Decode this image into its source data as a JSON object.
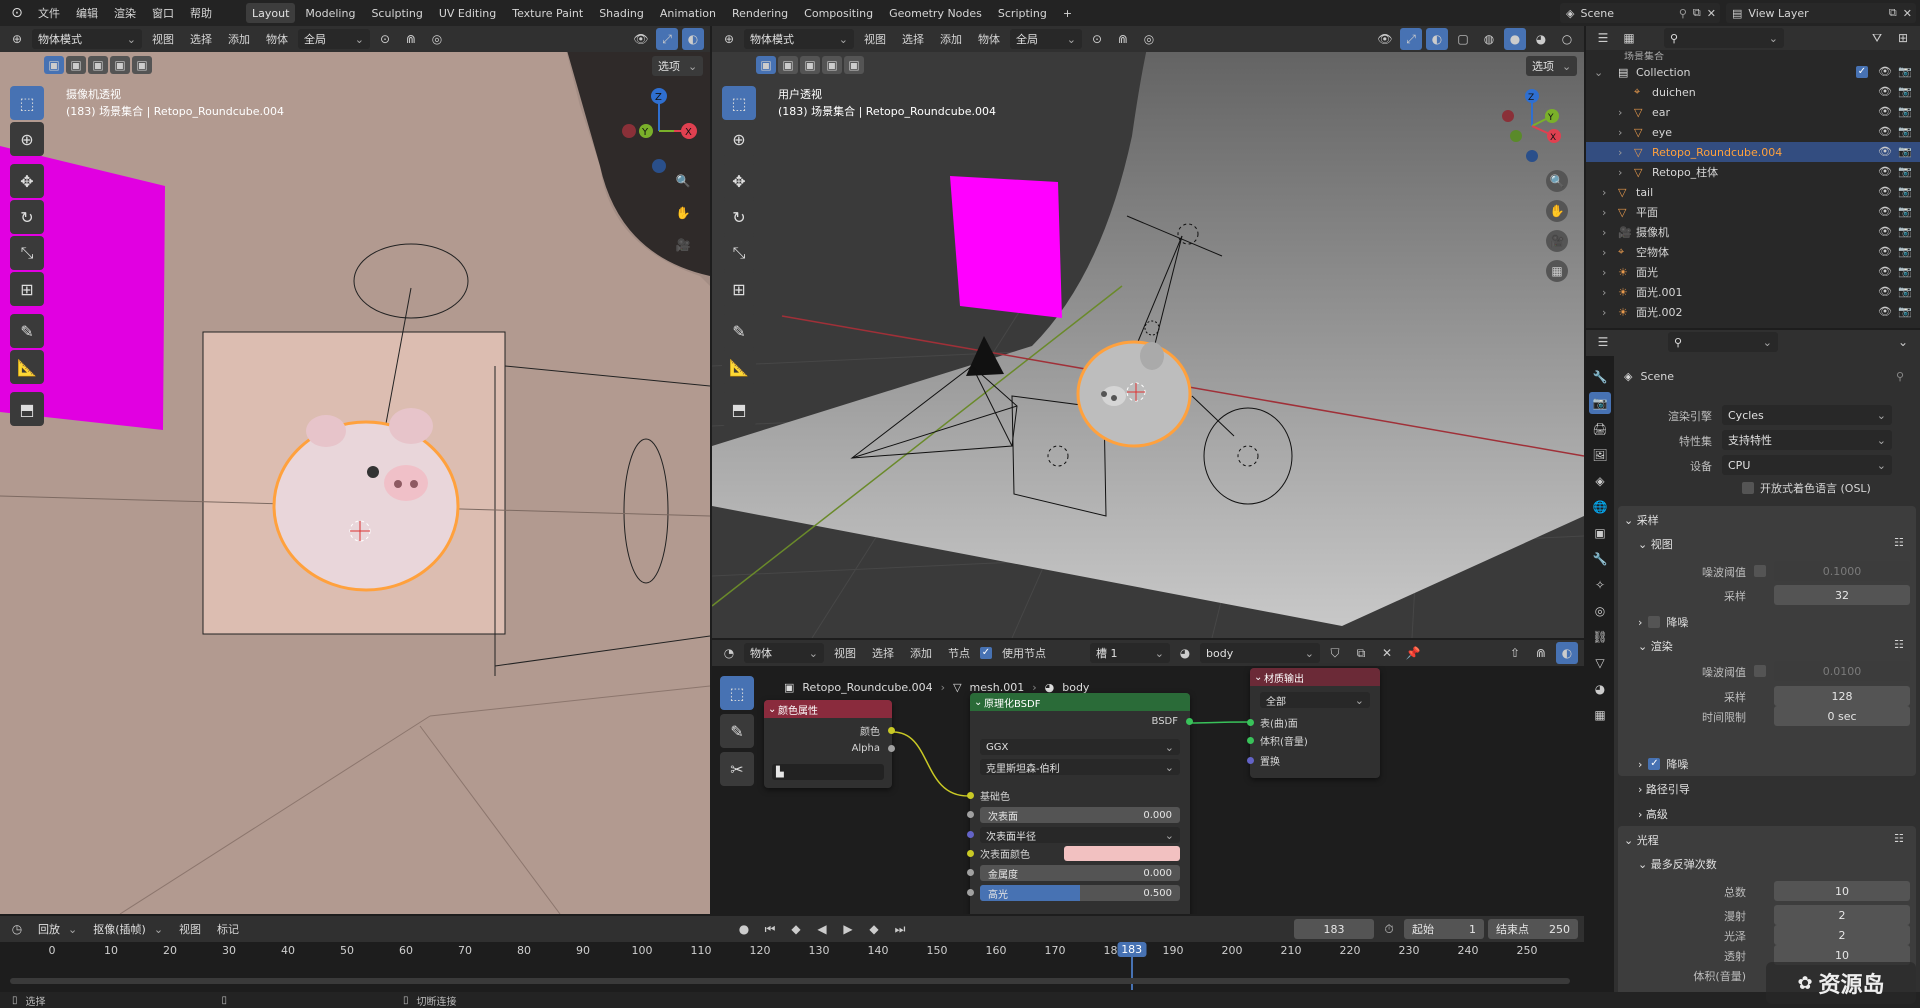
{
  "topbar": {
    "menus": [
      "文件",
      "编辑",
      "渲染",
      "窗口",
      "帮助"
    ],
    "workspaces": [
      "Layout",
      "Modeling",
      "Sculpting",
      "UV Editing",
      "Texture Paint",
      "Shading",
      "Animation",
      "Rendering",
      "Compositing",
      "Geometry Nodes",
      "Scripting"
    ],
    "add_workspace": "+",
    "scene": "Scene",
    "view_layer": "View Layer"
  },
  "vp_left": {
    "mode": "物体模式",
    "menus": [
      "视图",
      "选择",
      "添加",
      "物体"
    ],
    "orientation": "全局",
    "options": "选项",
    "title": "摄像机透视",
    "subtitle": "(183) 场景集合 | Retopo_Roundcube.004",
    "gizmo": {
      "x": "X",
      "y": "Y",
      "z": "Z"
    }
  },
  "vp_right": {
    "mode": "物体模式",
    "menus": [
      "视图",
      "选择",
      "添加",
      "物体"
    ],
    "orientation": "全局",
    "options": "选项",
    "title": "用户透视",
    "subtitle": "(183) 场景集合 | Retopo_Roundcube.004",
    "gizmo": {
      "x": "X",
      "y": "Y",
      "z": "Z"
    }
  },
  "node_editor": {
    "object_mode": "物体",
    "menus": [
      "视图",
      "选择",
      "添加",
      "节点"
    ],
    "use_nodes": "使用节点",
    "slot": "槽 1",
    "material": "body",
    "breadcrumb": [
      "Retopo_Roundcube.004",
      "mesh.001",
      "body"
    ],
    "node_color_attr": {
      "title": "颜色属性",
      "out_color": "颜色",
      "out_alpha": "Alpha",
      "field": "▙"
    },
    "node_bsdf": {
      "title": "原理化BSDF",
      "out": "BSDF",
      "dist": "GGX",
      "sss_method": "克里斯坦森-伯利",
      "base_color": "基础色",
      "subsurface": "次表面",
      "subsurface_val": "0.000",
      "subsurface_radius": "次表面半径",
      "subsurface_color": "次表面颜色",
      "metallic": "金属度",
      "metallic_val": "0.000",
      "specular": "高光",
      "specular_val": "0.500",
      "specular_fill": 0.5,
      "subsurface_color_hex": "#f2c1c1"
    },
    "node_output": {
      "title": "材质输出",
      "target": "全部",
      "surface": "表(曲)面",
      "volume": "体积(音量)",
      "displacement": "置换"
    }
  },
  "outliner": {
    "top": "场景集合",
    "items": [
      {
        "label": "Collection",
        "depth": 1,
        "type": "collection",
        "checked": true
      },
      {
        "label": "duichen",
        "depth": 2,
        "type": "empty"
      },
      {
        "label": "ear",
        "depth": 2,
        "type": "mesh",
        "expand": true
      },
      {
        "label": "eye",
        "depth": 2,
        "type": "mesh",
        "expand": true
      },
      {
        "label": "Retopo_Roundcube.004",
        "depth": 2,
        "type": "mesh",
        "expand": true,
        "selected": true
      },
      {
        "label": "Retopo_柱体",
        "depth": 2,
        "type": "mesh",
        "expand": true
      },
      {
        "label": "tail",
        "depth": 1,
        "type": "mesh",
        "expand": true
      },
      {
        "label": "平面",
        "depth": 1,
        "type": "mesh",
        "expand": true
      },
      {
        "label": "摄像机",
        "depth": 1,
        "type": "camera",
        "expand": true
      },
      {
        "label": "空物体",
        "depth": 1,
        "type": "empty",
        "expand": true
      },
      {
        "label": "面光",
        "depth": 1,
        "type": "light",
        "expand": true
      },
      {
        "label": "面光.001",
        "depth": 1,
        "type": "light",
        "expand": true
      },
      {
        "label": "面光.002",
        "depth": 1,
        "type": "light",
        "expand": true
      }
    ]
  },
  "properties": {
    "scene": "Scene",
    "render_engine_label": "渲染引擎",
    "render_engine": "Cycles",
    "feature_set_label": "特性集",
    "feature_set": "支持特性",
    "device_label": "设备",
    "device": "CPU",
    "osl": "开放式着色语言 (OSL)",
    "sampling": "采样",
    "viewport": "视图",
    "noise_threshold": "噪波阈值",
    "vp_noise_val": "0.1000",
    "samples": "采样",
    "vp_samples": "32",
    "denoise": "降噪",
    "render": "渲染",
    "r_noise_val": "0.0100",
    "r_samples": "128",
    "time_limit": "时间限制",
    "time_limit_val": "0 sec",
    "path_guiding": "路径引导",
    "advanced": "高级",
    "light_paths": "光程",
    "max_bounces": "最多反弹次数",
    "total": "总数",
    "total_val": "10",
    "diffuse": "漫射",
    "diffuse_val": "2",
    "glossy": "光泽",
    "glossy_val": "2",
    "transmission": "透射",
    "transmission_val": "10",
    "volume": "体积(音量)"
  },
  "timeline": {
    "playback": "回放",
    "keying": "抠像(插帧)",
    "menus": [
      "视图",
      "标记"
    ],
    "current_frame": "183",
    "start_label": "起始",
    "start": "1",
    "end_label": "结束点",
    "end": "250",
    "ticks": [
      "0",
      "10",
      "20",
      "30",
      "40",
      "50",
      "60",
      "70",
      "80",
      "90",
      "100",
      "110",
      "120",
      "130",
      "140",
      "150",
      "160",
      "170",
      "180",
      "190",
      "200",
      "210",
      "220",
      "230",
      "240",
      "250"
    ],
    "playhead": "183"
  },
  "statusbar": {
    "select": "选择",
    "cut": "切断连接",
    "watermark": "资源岛"
  },
  "colors": {
    "accent": "#4772b3",
    "selected_orange": "#ffa13d",
    "magenta": "#ff00ff",
    "green_node": "#2a6b38",
    "red_node": "#6b2a37"
  }
}
